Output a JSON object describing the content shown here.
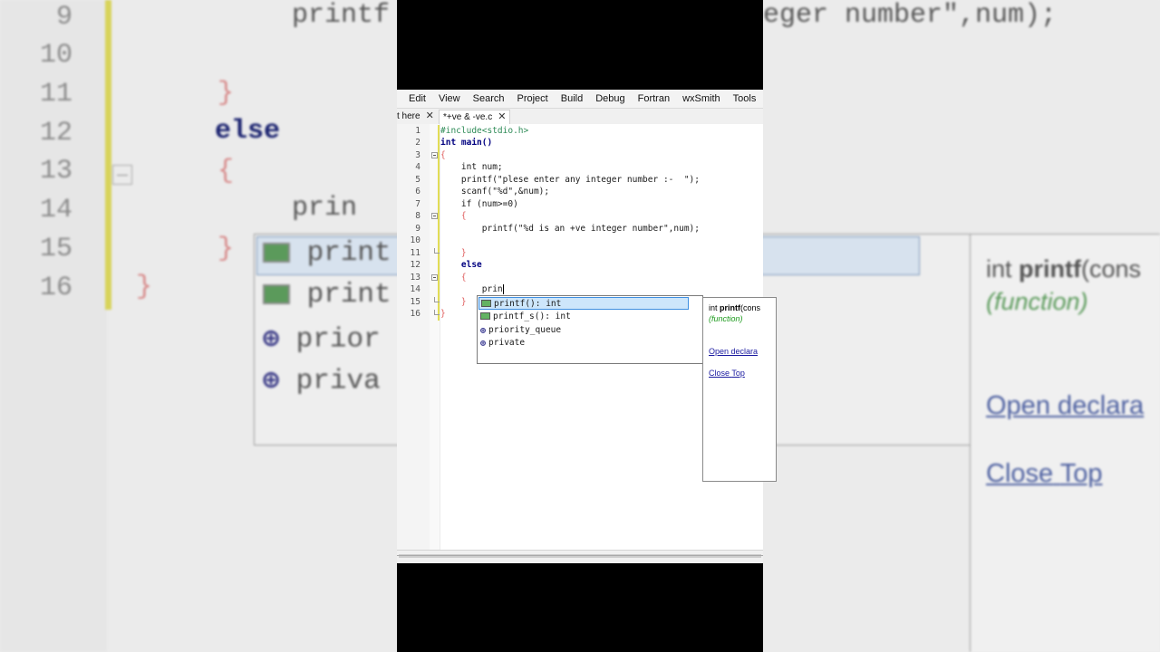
{
  "menu": [
    "Edit",
    "View",
    "Search",
    "Project",
    "Build",
    "Debug",
    "Fortran",
    "wxSmith",
    "Tools"
  ],
  "tabs": {
    "partial_label": "t here",
    "active_label": "*+ve & -ve.c",
    "close_glyph": "✕"
  },
  "editor": {
    "line_numbers": [
      "1",
      "2",
      "3",
      "4",
      "5",
      "6",
      "7",
      "8",
      "9",
      "10",
      "11",
      "12",
      "13",
      "14",
      "15",
      "16"
    ],
    "lines": [
      "#include<stdio.h>",
      "int main()",
      "{",
      "    int num;",
      "    printf(\"plese enter any integer number :-  \");",
      "    scanf(\"%d\",&num);",
      "    if (num>=0)",
      "    {",
      "        printf(\"%d is an +ve integer number\",num);",
      "",
      "    }",
      "    else",
      "    {",
      "        prin",
      "    }",
      "}"
    ],
    "typed_text": "prin"
  },
  "autocomplete": {
    "items": [
      {
        "label": "printf(): int",
        "icon": "function-icon"
      },
      {
        "label": "printf_s(): int",
        "icon": "function-icon"
      },
      {
        "label": "priority_queue",
        "icon": "class-icon"
      },
      {
        "label": "private",
        "icon": "class-icon"
      }
    ],
    "selected_index": 0
  },
  "tooltip": {
    "signature_prefix": "int ",
    "signature_name": "printf",
    "signature_rest": "(cons",
    "kind": "(function)",
    "open_link": "Open declara",
    "close_link": "Close",
    "top_link": "Top"
  },
  "background_zoom": {
    "line_numbers": [
      "9",
      "10",
      "11",
      "12",
      "13",
      "14",
      "15",
      "16"
    ],
    "printf_left": "printf",
    "printf_right": "eger number\",num);",
    "brace_close": "}",
    "else_kw": "else",
    "brace_open": "{",
    "typed": "prin",
    "brace_end": "}",
    "brace_final": "}",
    "ac_items": [
      "print",
      "print",
      "prior",
      "priva"
    ],
    "tip_prefix": "int ",
    "tip_name": "printf",
    "tip_rest": "(cons",
    "tip_kind": "(function)",
    "tip_open": "Open declara",
    "tip_close": "Close",
    "tip_top": "Top"
  }
}
